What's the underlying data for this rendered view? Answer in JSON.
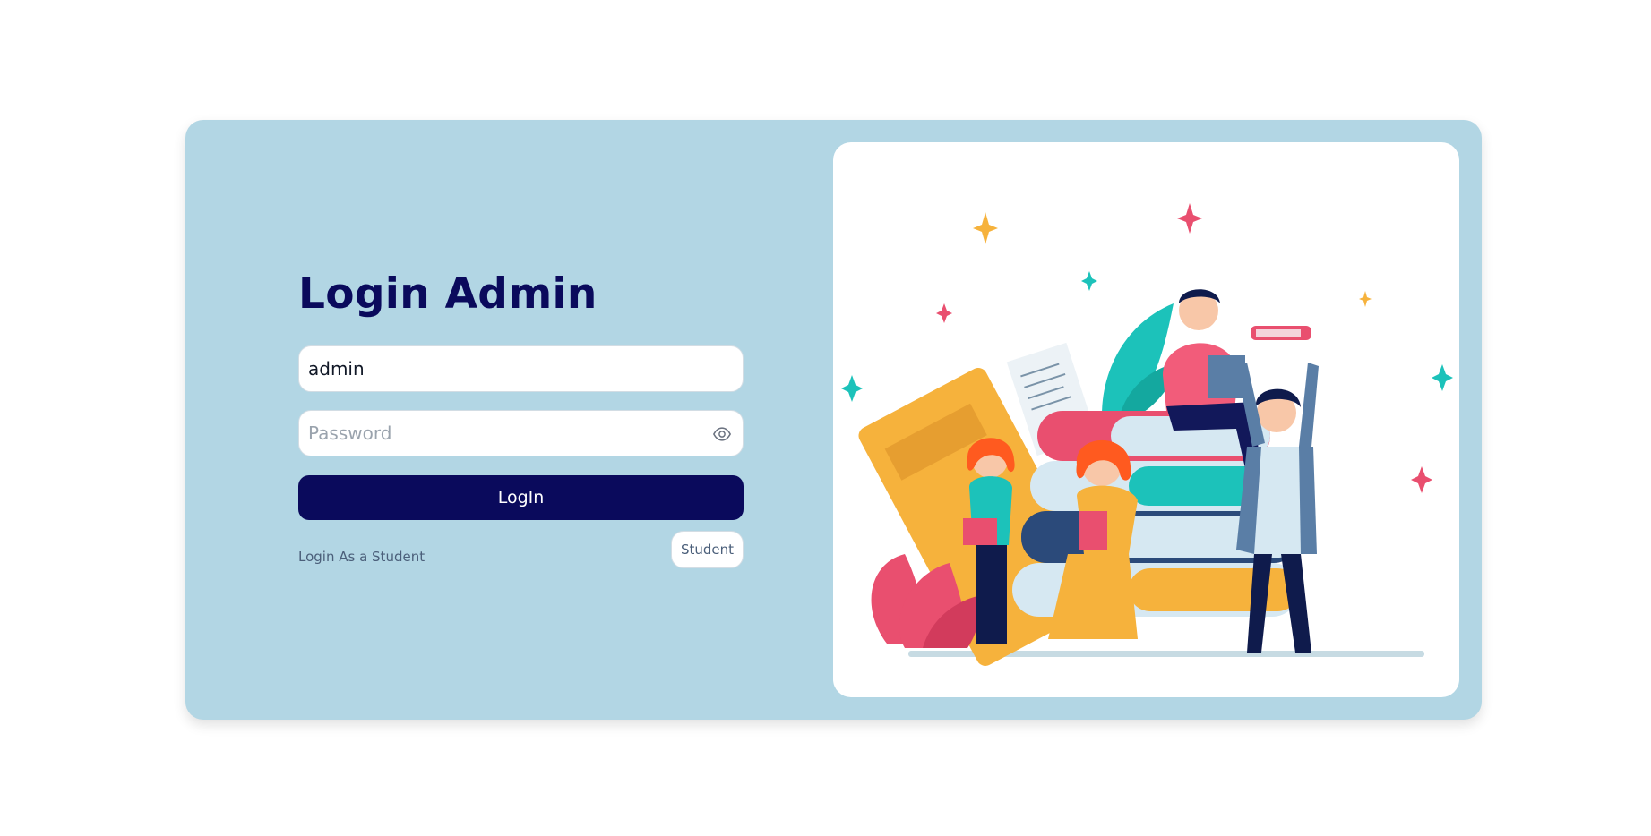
{
  "login": {
    "title": "Login Admin",
    "username_value": "admin",
    "password_placeholder": "Password",
    "login_label": "LogIn",
    "alt_text": "Login As a Student",
    "student_label": "Student"
  },
  "colors": {
    "card_bg": "#b2d6e4",
    "primary": "#0a0a5c",
    "muted_text": "#4b5f7a"
  },
  "icons": {
    "password_toggle": "eye-icon"
  }
}
